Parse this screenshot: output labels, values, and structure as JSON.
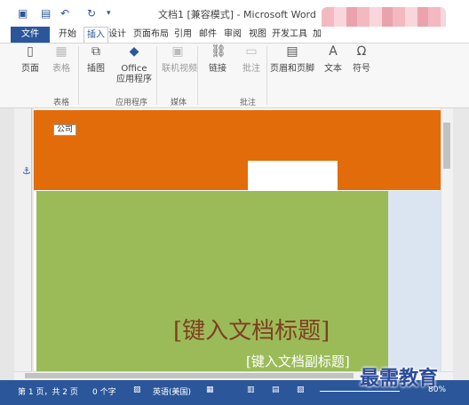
{
  "window": {
    "title": "文档1 [兼容模式] - Microsoft Word"
  },
  "quick_access": {
    "undo_glyph": "↶",
    "redo_glyph": "↻",
    "customize_glyph": "▾"
  },
  "tabs": {
    "file": "文件",
    "items": [
      "开始",
      "插入",
      "设计",
      "页面布局",
      "引用",
      "邮件",
      "审阅",
      "视图",
      "开发工具",
      "加"
    ],
    "active_index": 1
  },
  "ribbon": {
    "buttons": [
      {
        "label": "页面",
        "icon": "page-icon",
        "dim": false
      },
      {
        "label": "表格",
        "icon": "table-icon",
        "dim": true
      },
      {
        "label": "插图",
        "icon": "illustrations-icon",
        "dim": false
      },
      {
        "label": "Office\n应用程序",
        "icon": "office-apps-icon",
        "dim": false
      },
      {
        "label": "联机视频",
        "icon": "online-video-icon",
        "dim": true
      },
      {
        "label": "链接",
        "icon": "link-icon",
        "dim": false
      },
      {
        "label": "批注",
        "icon": "comment-icon",
        "dim": true
      },
      {
        "label": "页眉和页脚",
        "icon": "header-footer-icon",
        "dim": false
      },
      {
        "label": "文本",
        "icon": "text-icon",
        "dim": false
      },
      {
        "label": "符号",
        "icon": "symbol-icon",
        "dim": false
      }
    ],
    "groups": [
      "表格",
      "应用程序",
      "媒体",
      "批注"
    ]
  },
  "document": {
    "company_field": "公司",
    "title_placeholder": "[键入文档标题]",
    "subtitle_placeholder": "[键入文档副标题]",
    "colors": {
      "orange": "#e36c0a",
      "green": "#9bbb59",
      "blue": "#dbe5f1",
      "title": "#7f3f1f"
    }
  },
  "status_bar": {
    "page": "第 1 页，共 2 页",
    "words": "0 个字",
    "language": "英语(美国)",
    "zoom": "80%"
  },
  "watermark": "最需教育"
}
